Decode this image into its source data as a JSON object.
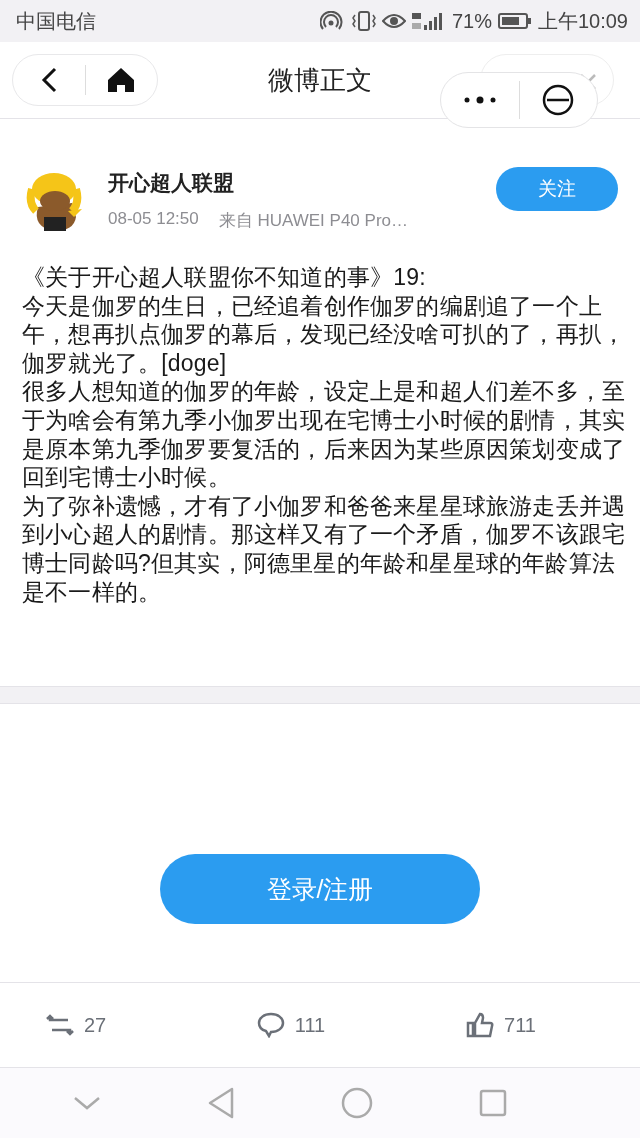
{
  "status_bar": {
    "carrier": "中国电信",
    "battery_text": "71%",
    "time": "上午10:09"
  },
  "nav": {
    "title": "微博正文"
  },
  "post": {
    "author": "开心超人联盟",
    "time": "08-05 12:50",
    "source": "来自  HUAWEI  P40  Pro…",
    "follow_label": "关注",
    "paragraphs": [
      "《关于开心超人联盟你不知道的事》19:",
      "今天是伽罗的生日，已经追着创作伽罗的编剧追了一个上午，想再扒点伽罗的幕后，发现已经没啥可扒的了，再扒，伽罗就光了。[doge]",
      "很多人想知道的伽罗的年龄，设定上是和超人们差不多，至于为啥会有第九季小伽罗出现在宅博士小时候的剧情，其实是原本第九季伽罗要复活的，后来因为某些原因策划变成了回到宅博士小时候。",
      "为了弥补遗憾，才有了小伽罗和爸爸来星星球旅游走丢并遇到小心超人的剧情。那这样又有了一个矛盾，伽罗不该跟宅博士同龄吗?但其实，阿德里星的年龄和星星球的年龄算法是不一样的。"
    ]
  },
  "login_button": "登录/注册",
  "actions": [
    {
      "kind": "repost",
      "count": "27"
    },
    {
      "kind": "comment",
      "count": "111"
    },
    {
      "kind": "like",
      "count": "711"
    }
  ]
}
